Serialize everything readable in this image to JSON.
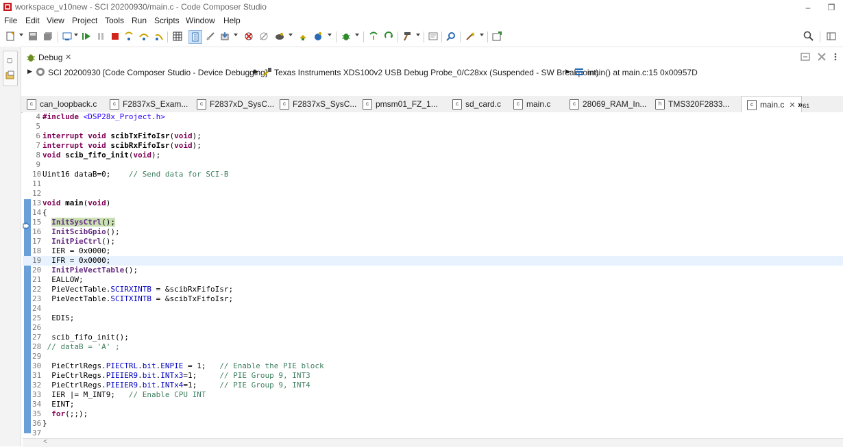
{
  "window": {
    "title": "workspace_v10new - SCI 20200930/main.c - Code Composer Studio",
    "controls": [
      "–",
      "❐"
    ]
  },
  "menu": [
    "File",
    "Edit",
    "View",
    "Project",
    "Tools",
    "Run",
    "Scripts",
    "Window",
    "Help"
  ],
  "debug_view": {
    "tab_label": "Debug",
    "tab_close": "✕",
    "items": [
      "SCI 20200930 [Code Composer Studio - Device Debugging]",
      "Texas Instruments XDS100v2 USB Debug Probe_0/C28xx (Suspended - SW Breakpoint)",
      "main() at main.c:15 0x00957D"
    ]
  },
  "editor_tabs": {
    "items": [
      {
        "label": "can_loopback.c",
        "icon": "c"
      },
      {
        "label": "F2837xS_Exam...",
        "icon": "c"
      },
      {
        "label": "F2837xD_SysC...",
        "icon": "c"
      },
      {
        "label": "F2837xS_SysC...",
        "icon": "c"
      },
      {
        "label": "pmsm01_FZ_1...",
        "icon": "c"
      },
      {
        "label": "sd_card.c",
        "icon": "c"
      },
      {
        "label": "main.c",
        "icon": "c"
      },
      {
        "label": "28069_RAM_In...",
        "icon": "c"
      },
      {
        "label": "TMS320F2833...",
        "icon": "h"
      },
      {
        "label": "main.c",
        "icon": "c"
      }
    ],
    "active_close": "✕",
    "overflow_label": "»",
    "overflow_count": "61"
  },
  "code": {
    "lines": [
      {
        "n": "4",
        "html": "<span class=\"kw\">#include</span> <span class=\"inc\">&lt;DSP28x_Project.h&gt;</span>"
      },
      {
        "n": "5",
        "html": ""
      },
      {
        "n": "6",
        "html": "<span class=\"kw\">interrupt</span> <span class=\"kw\">void</span> <span class=\"fn\">scibTxFifoIsr</span>(<span class=\"kw\">void</span>);"
      },
      {
        "n": "7",
        "html": "<span class=\"kw\">interrupt</span> <span class=\"kw\">void</span> <span class=\"fn\">scibRxFifoIsr</span>(<span class=\"kw\">void</span>);"
      },
      {
        "n": "8",
        "html": "<span class=\"kw\">void</span> <span class=\"fn\">scib_fifo_init</span>(<span class=\"kw\">void</span>);"
      },
      {
        "n": "9",
        "html": ""
      },
      {
        "n": "10",
        "html": "Uint16 dataB=0;    <span class=\"cm\">// Send data for SCI-B</span>"
      },
      {
        "n": "11",
        "html": ""
      },
      {
        "n": "12",
        "html": ""
      },
      {
        "n": "13",
        "html": "<span class=\"kw\">void</span> <span class=\"fn\">main</span>(<span class=\"kw\">void</span>)"
      },
      {
        "n": "14",
        "html": "{"
      },
      {
        "n": "15",
        "html": "  <span class=\"cur-call\"><span class=\"fn2\">InitSysCtrl</span>();</span>"
      },
      {
        "n": "16",
        "html": "  <span class=\"fn2\">InitScibGpio</span>();"
      },
      {
        "n": "17",
        "html": "  <span class=\"fn2\">InitPieCtrl</span>();"
      },
      {
        "n": "18",
        "html": "  IER = 0x0000;"
      },
      {
        "n": "19",
        "html": "  IFR = 0x0000;"
      },
      {
        "n": "20",
        "html": "  <span class=\"fn2\">InitPieVectTable</span>();"
      },
      {
        "n": "21",
        "html": "  EALLOW;"
      },
      {
        "n": "22",
        "html": "  PieVectTable.<span class=\"field\">SCIRXINTB</span> = &amp;scibRxFifoIsr;"
      },
      {
        "n": "23",
        "html": "  PieVectTable.<span class=\"field\">SCITXINTB</span> = &amp;scibTxFifoIsr;"
      },
      {
        "n": "24",
        "html": ""
      },
      {
        "n": "25",
        "html": "  EDIS;"
      },
      {
        "n": "26",
        "html": ""
      },
      {
        "n": "27",
        "html": "  scib_fifo_init();"
      },
      {
        "n": "28",
        "html": " <span class=\"cm\">// dataB = 'A' ;</span>"
      },
      {
        "n": "29",
        "html": ""
      },
      {
        "n": "30",
        "html": "  PieCtrlRegs.<span class=\"field\">PIECTRL</span>.<span class=\"field\">bit</span>.<span class=\"field\">ENPIE</span> = 1;   <span class=\"cm\">// Enable the PIE block</span>"
      },
      {
        "n": "31",
        "html": "  PieCtrlRegs.<span class=\"field\">PIEIER9</span>.<span class=\"field\">bit</span>.<span class=\"field\">INTx3</span>=1;     <span class=\"cm\">// PIE Group 9, INT3</span>"
      },
      {
        "n": "32",
        "html": "  PieCtrlRegs.<span class=\"field\">PIEIER9</span>.<span class=\"field\">bit</span>.<span class=\"field\">INTx4</span>=1;     <span class=\"cm\">// PIE Group 9, INT4</span>"
      },
      {
        "n": "33",
        "html": "  IER |= M_INT9;   <span class=\"cm\">// Enable CPU INT</span>"
      },
      {
        "n": "34",
        "html": "  EINT;"
      },
      {
        "n": "35",
        "html": "  <span class=\"kw\">for</span>(;;);"
      },
      {
        "n": "36",
        "html": "}"
      },
      {
        "n": "37",
        "html": ""
      }
    ],
    "current_line": "15",
    "highlighted_line": "19"
  },
  "colors": {
    "keyword": "#7f0055",
    "comment": "#3f7f5f",
    "field": "#0000c0",
    "current_instruction_bg": "#c9e0b4",
    "highlighted_line_bg": "#e8f2fe"
  }
}
